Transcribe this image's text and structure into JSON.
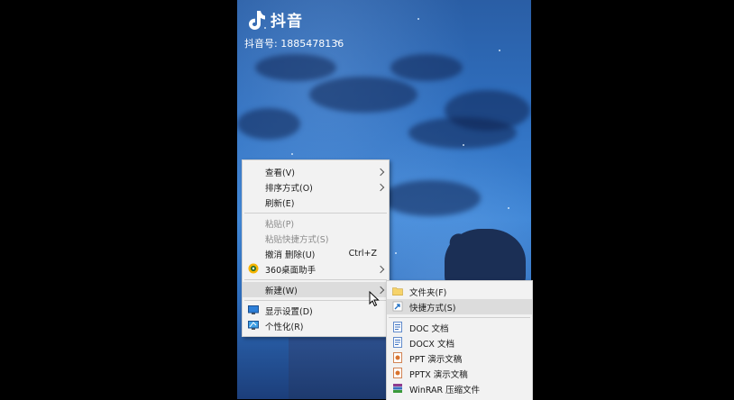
{
  "overlay": {
    "app_name": "抖音",
    "account": "抖音号: 1885478136"
  },
  "context_menu": {
    "items": [
      {
        "label": "查看(V)",
        "submenu": true
      },
      {
        "label": "排序方式(O)",
        "submenu": true
      },
      {
        "label": "刷新(E)"
      },
      {
        "label": "粘贴(P)",
        "disabled": true
      },
      {
        "label": "粘贴快捷方式(S)",
        "disabled": true
      },
      {
        "label": "撤消 删除(U)",
        "shortcut": "Ctrl+Z"
      },
      {
        "label": "360桌面助手",
        "submenu": true,
        "icon": "360-assistant-icon"
      },
      {
        "label": "新建(W)",
        "submenu": true,
        "highlighted": true
      },
      {
        "label": "显示设置(D)",
        "icon": "display-settings-icon"
      },
      {
        "label": "个性化(R)",
        "icon": "personalize-icon"
      }
    ]
  },
  "new_submenu": {
    "items": [
      {
        "label": "文件夹(F)",
        "icon": "folder-icon"
      },
      {
        "label": "快捷方式(S)",
        "icon": "shortcut-icon",
        "highlighted": true
      },
      {
        "label": "DOC 文档",
        "icon": "doc-icon"
      },
      {
        "label": "DOCX 文档",
        "icon": "docx-icon"
      },
      {
        "label": "PPT 演示文稿",
        "icon": "ppt-icon"
      },
      {
        "label": "PPTX 演示文稿",
        "icon": "pptx-icon"
      },
      {
        "label": "WinRAR 压缩文件",
        "icon": "winrar-icon"
      }
    ]
  },
  "colors": {
    "menu_bg": "#f2f2f2",
    "highlight": "#dcdcdc",
    "sky": "#2f6fbf"
  }
}
